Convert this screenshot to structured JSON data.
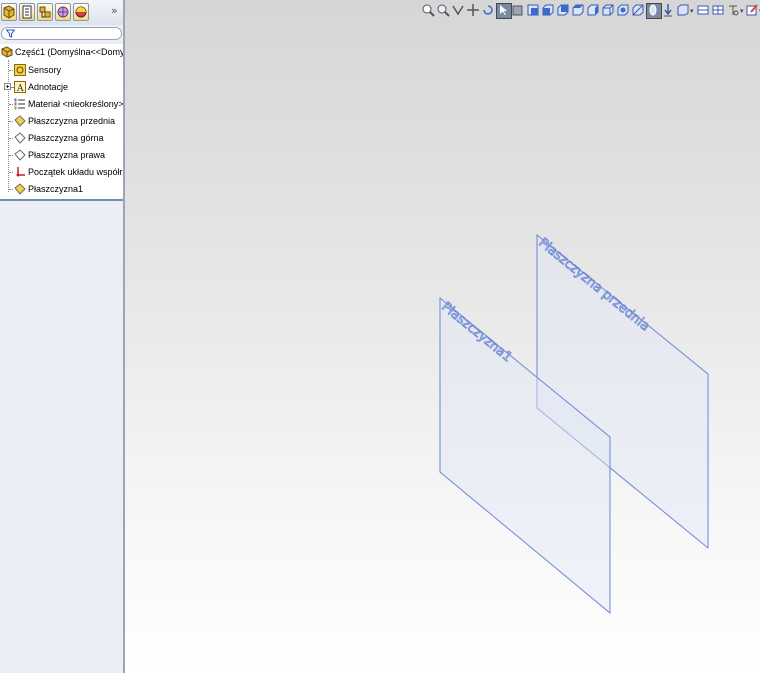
{
  "feature_manager": {
    "tabs": [
      {
        "name": "featuremanager-tab",
        "icon": "part-tree-icon"
      },
      {
        "name": "propertymanager-tab",
        "icon": "property-sheet-icon"
      },
      {
        "name": "configurationmanager-tab",
        "icon": "configuration-icon"
      },
      {
        "name": "dimxpert-tab",
        "icon": "dimxpert-icon"
      },
      {
        "name": "display-manager-tab",
        "icon": "appearance-icon"
      }
    ],
    "more_glyph": "»",
    "tree": {
      "root": "Część1  (Domyślna<<Domyśln",
      "items": [
        {
          "label": "Sensory",
          "icon": "sensor-icon"
        },
        {
          "label": "Adnotacje",
          "icon": "annotation-icon"
        },
        {
          "label": "Materiał <nieokreślony>",
          "icon": "material-icon"
        },
        {
          "label": "Płaszczyzna przednia",
          "icon": "plane-icon"
        },
        {
          "label": "Płaszczyzna górna",
          "icon": "plane-icon"
        },
        {
          "label": "Płaszczyzna prawa",
          "icon": "plane-icon"
        },
        {
          "label": "Początek układu współrzędn",
          "icon": "origin-icon"
        },
        {
          "label": "Płaszczyzna1",
          "icon": "plane-icon"
        }
      ]
    }
  },
  "viewport": {
    "planes": [
      {
        "label": "Płaszczyzna przednia"
      },
      {
        "label": "Płaszczyzna1"
      }
    ],
    "colors": {
      "plane_edge": "#6b87d6",
      "plane_fill": "#dfe7f6",
      "tree_separator": "#6f8fb8"
    }
  },
  "heads_up_toolbar": {
    "buttons": [
      "zoom-to-fit-icon",
      "zoom-to-area-icon",
      "previous-view-icon",
      "pan-icon",
      "rotate-icon",
      "select-icon",
      "section-view-icon",
      "view-orientation-icon",
      "front-view-icon",
      "back-view-icon",
      "top-view-icon",
      "isometric-view-icon",
      "display-style-icon",
      "hide-show-icon",
      "edit-appearance-icon",
      "apply-scene-icon",
      "view-settings-icon",
      "single-view-icon",
      "two-view-icon",
      "link-views-icon",
      "lights-icon"
    ]
  }
}
